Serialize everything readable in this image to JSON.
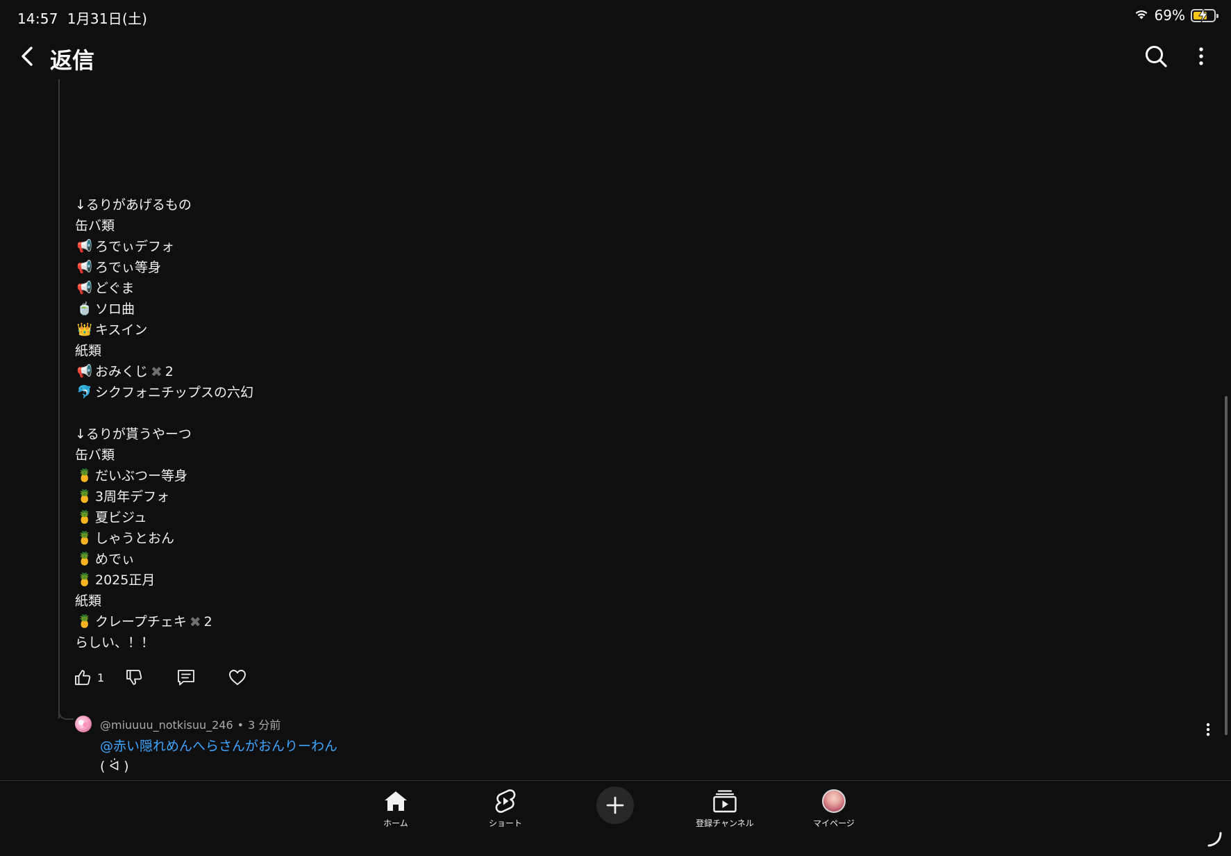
{
  "status_bar": {
    "time": "14:57",
    "date": "1月31日(土)",
    "battery_percent": "69%",
    "battery_level": 0.69,
    "battery_color": "#f5c518"
  },
  "header": {
    "back_icon": "chevron-left-icon",
    "title": "返信",
    "search_icon": "search-icon",
    "more_icon": "more-vertical-icon"
  },
  "comment": {
    "lines": [
      {
        "emoji": "",
        "text": "↓るりがあげるもの"
      },
      {
        "emoji": "",
        "text": "缶バ類"
      },
      {
        "emoji": "📢",
        "text": "ろでぃデフォ"
      },
      {
        "emoji": "📢",
        "text": "ろでぃ等身"
      },
      {
        "emoji": "📢",
        "text": "どぐま"
      },
      {
        "emoji": "🍵",
        "text": "ソロ曲"
      },
      {
        "emoji": "👑",
        "text": "キスイン"
      },
      {
        "emoji": "",
        "text": "紙類"
      },
      {
        "emoji": "📢",
        "text": "おみくじ",
        "cross": "✖",
        "suffix": "2"
      },
      {
        "emoji": "🐬",
        "text": "シクフォニチップスの六幻"
      },
      {
        "emoji": "",
        "text": ""
      },
      {
        "emoji": "",
        "text": "↓るりが貰うやーつ"
      },
      {
        "emoji": "",
        "text": "缶バ類"
      },
      {
        "emoji": "🍍",
        "text": "だいぶつー等身"
      },
      {
        "emoji": "🍍",
        "text": "3周年デフォ"
      },
      {
        "emoji": "🍍",
        "text": "夏ビジュ"
      },
      {
        "emoji": "🍍",
        "text": "しゃうとおん"
      },
      {
        "emoji": "🍍",
        "text": "めでぃ"
      },
      {
        "emoji": "🍍",
        "text": "2025正月"
      },
      {
        "emoji": "",
        "text": "紙類"
      },
      {
        "emoji": "🍍",
        "text": "クレープチェキ",
        "cross": "✖",
        "suffix": "2"
      },
      {
        "emoji": "",
        "text": "らしい、！！"
      }
    ],
    "actions": {
      "like_count": "1",
      "like_icon": "thumbs-up-icon",
      "dislike_icon": "thumbs-down-icon",
      "reply_icon": "comment-icon",
      "heart_icon": "heart-icon"
    }
  },
  "reply": {
    "username": "@miuuuu_notkisuu_246",
    "separator": "•",
    "time": "3 分前",
    "mention": "@赤い隠れめんへらさんがおんりーわん",
    "text": "( ᐛ )",
    "more_icon": "more-vertical-icon"
  },
  "bottom_nav": {
    "items": [
      {
        "label": "ホーム",
        "icon": "home-icon"
      },
      {
        "label": "ショート",
        "icon": "shorts-icon"
      },
      {
        "label": "",
        "icon": "plus-icon"
      },
      {
        "label": "登録チャンネル",
        "icon": "subscriptions-icon"
      },
      {
        "label": "マイページ",
        "icon": "avatar"
      }
    ]
  }
}
